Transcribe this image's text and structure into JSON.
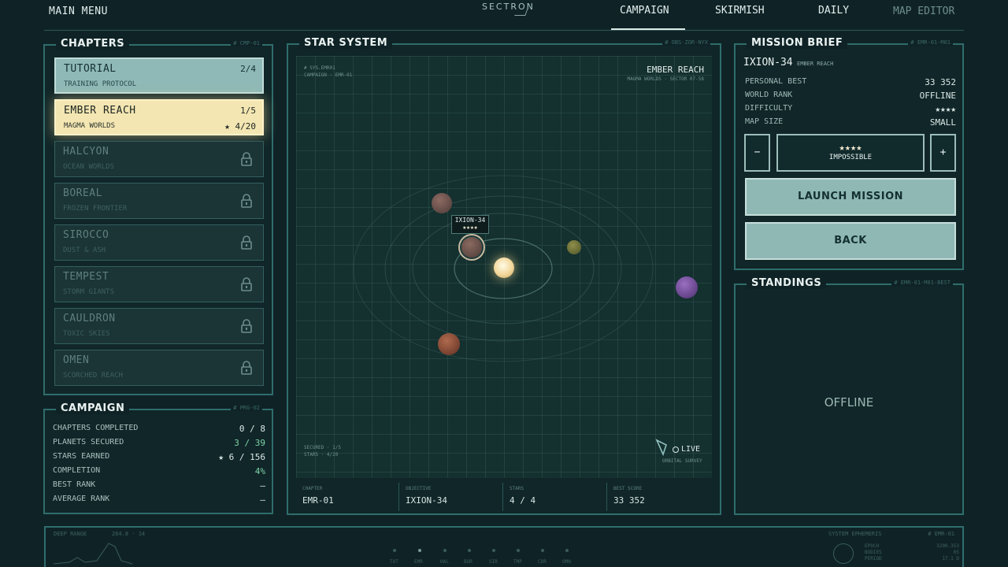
{
  "top": {
    "main_menu": "MAIN MENU",
    "logo": "SECTRON",
    "nav": [
      "CAMPAIGN",
      "SKIRMISH",
      "DAILY",
      "MAP EDITOR"
    ]
  },
  "chapters_panel": {
    "title": "CHAPTERS",
    "code": "# CMP-01",
    "items": [
      {
        "name": "TUTORIAL",
        "sub": "TRAINING PROTOCOL",
        "progress": "2/4",
        "state": "done"
      },
      {
        "name": "EMBER REACH",
        "sub": "MAGMA WORLDS",
        "progress": "1/5",
        "stars": "★ 4/20",
        "state": "active"
      },
      {
        "name": "HALCYON",
        "sub": "OCEAN WORLDS",
        "state": "locked"
      },
      {
        "name": "BOREAL",
        "sub": "FROZEN FRONTIER",
        "state": "locked"
      },
      {
        "name": "SIROCCO",
        "sub": "DUST & ASH",
        "state": "locked"
      },
      {
        "name": "TEMPEST",
        "sub": "STORM GIANTS",
        "state": "locked"
      },
      {
        "name": "CAULDRON",
        "sub": "TOXIC SKIES",
        "state": "locked"
      },
      {
        "name": "OMEN",
        "sub": "SCORCHED REACH",
        "state": "locked"
      }
    ]
  },
  "campaign_panel": {
    "title": "CAMPAIGN",
    "code": "# PRG-02",
    "rows": [
      {
        "label": "CHAPTERS COMPLETED",
        "value": "0 / 8"
      },
      {
        "label": "PLANETS SECURED",
        "value": "3 / 39"
      },
      {
        "label": "STARS EARNED",
        "value": "★ 6 / 156"
      },
      {
        "label": "COMPLETION",
        "value": "4%"
      },
      {
        "label": "BEST RANK",
        "value": "—"
      },
      {
        "label": "AVERAGE RANK",
        "value": "—"
      }
    ]
  },
  "star_system": {
    "title": "STAR SYSTEM",
    "code": "# OBS-ZOR-NYX",
    "meta_top_left": [
      "# SYS.EMR01",
      "CAMPAIGN · EMR-01"
    ],
    "system_name": "EMBER REACH",
    "system_sub": "MAGMA WORLDS · SECTOR 07-58",
    "meta_bottom_left": [
      "SECURED · 1/5",
      "STARS · 4/20"
    ],
    "selected_planet": "IXION-34",
    "selected_stars": "★★★★",
    "live": "LIVE",
    "live_sub": "ORBITAL SURVEY",
    "footer": [
      {
        "key": "CHAPTER",
        "value": "EMR-01"
      },
      {
        "key": "OBJECTIVE",
        "value": "IXION-34"
      },
      {
        "key": "STARS",
        "value": "4 / 4"
      },
      {
        "key": "BEST SCORE",
        "value": "33 352"
      }
    ]
  },
  "mission_brief": {
    "title": "MISSION BRIEF",
    "code": "# EMR-01-M01",
    "planet": "IXION-34",
    "planet_sub": "EMBER REACH",
    "rows": [
      {
        "label": "PERSONAL BEST",
        "value": "33 352"
      },
      {
        "label": "WORLD RANK",
        "value": "OFFLINE"
      },
      {
        "label": "DIFFICULTY",
        "value": "★★★★"
      },
      {
        "label": "MAP SIZE",
        "value": "SMALL"
      }
    ],
    "minus": "−",
    "plus": "+",
    "difficulty_stars": "★★★★",
    "difficulty_label": "IMPOSSIBLE",
    "launch": "LAUNCH MISSION",
    "back": "BACK"
  },
  "standings": {
    "title": "STANDINGS",
    "code": "# EMR-01-M01-BEST",
    "status": "OFFLINE"
  },
  "bottom": {
    "left_label": "DEEP RANGE",
    "left_value": "264.8 · 14",
    "right_label": "SYSTEM EPHEMERIS",
    "right_code": "# EMR-01",
    "nodes": [
      "TUT",
      "EMR",
      "HAL",
      "BOR",
      "SIR",
      "TMP",
      "CDR",
      "OMN"
    ],
    "ephemeris": [
      {
        "k": "EPOCH",
        "v": "3200.353"
      },
      {
        "k": "BODIES",
        "v": "05"
      },
      {
        "k": "PERIOD",
        "v": "17.1 D"
      }
    ]
  },
  "colors": {
    "accent": "#2f6d6c",
    "active_chapter": "#f3e6b2",
    "done_chapter": "#8fb9b6",
    "green": "#7fd3a8"
  }
}
